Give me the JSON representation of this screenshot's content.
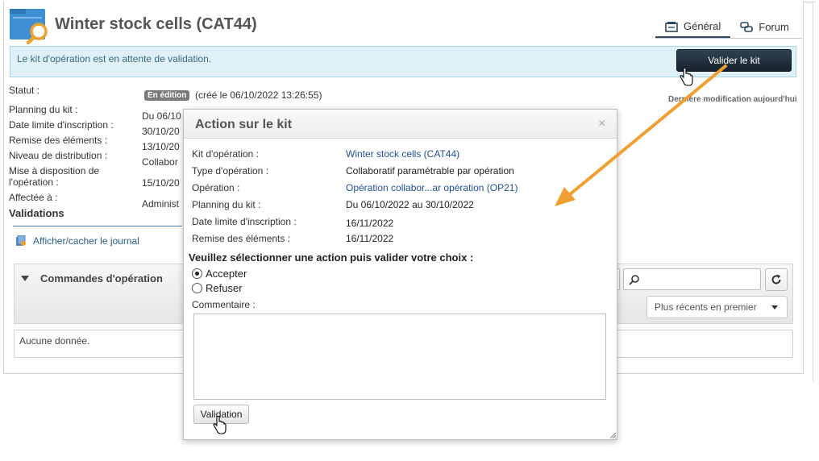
{
  "header": {
    "title": "Winter stock cells (CAT44)",
    "tabs": [
      {
        "label": "Général",
        "active": true,
        "icon": "general-icon"
      },
      {
        "label": "Forum",
        "active": false,
        "icon": "forum-icon"
      }
    ]
  },
  "banner": {
    "text": "Le kit d'opération est en attente de validation.",
    "button_label": "Valider le kit"
  },
  "details": {
    "status_label": "Statut :",
    "status_badge": "En édition",
    "status_created": "(créé le 06/10/2022 13:26:55)",
    "last_modified": "Dernière modification aujourd'hui",
    "fields": [
      {
        "label": "Planning du kit :",
        "value": "Du 06/10"
      },
      {
        "label": "Date limite d'inscription :",
        "value": "30/10/20"
      },
      {
        "label": "Remise des éléments :",
        "value": "13/10/20"
      },
      {
        "label": "Niveau de distribution :",
        "value": "Collabor"
      },
      {
        "label": "Mise à disposition de",
        "label2": "l'opération :",
        "value": "15/10/20"
      },
      {
        "label": "Affectée à :",
        "value": "Administ"
      }
    ],
    "validations_title": "Validations"
  },
  "journal_link": "Afficher/cacher le journal",
  "commands": {
    "title": "Commandes d'opération",
    "sort_selected": "Plus récents en premier",
    "no_data": "Aucune donnée."
  },
  "dialog": {
    "title": "Action sur le kit",
    "close": "×",
    "rows": [
      {
        "label": "Kit d'opération :",
        "value": "Winter stock cells (CAT44)",
        "link": true
      },
      {
        "label": "Type d'opération :",
        "value": "Collaboratif paramétrable par opération",
        "link": false
      },
      {
        "label": "Opération :",
        "value": "Opération collabor...ar opération (OP21)",
        "link": true
      },
      {
        "label": "Planning du kit :",
        "value": "Du 06/10/2022 au 30/10/2022",
        "link": false
      },
      {
        "label": "Date limite d'inscription :",
        "value": "16/11/2022",
        "link": false
      },
      {
        "label": "Remise des éléments :",
        "value": "16/11/2022",
        "link": false
      }
    ],
    "instruction": "Veuillez sélectionner une action puis valider votre choix :",
    "options": [
      {
        "label": "Accepter",
        "checked": true
      },
      {
        "label": "Refuser",
        "checked": false
      }
    ],
    "comment_label": "Commentaire :",
    "comment_value": "",
    "validate_button": "Validation"
  },
  "colors": {
    "accent": "#2e4a62",
    "banner_bg": "#dff0f7",
    "link": "#1f4f95",
    "annotation_arrow": "#f0a030",
    "app_icon": "#3d8fd1"
  }
}
